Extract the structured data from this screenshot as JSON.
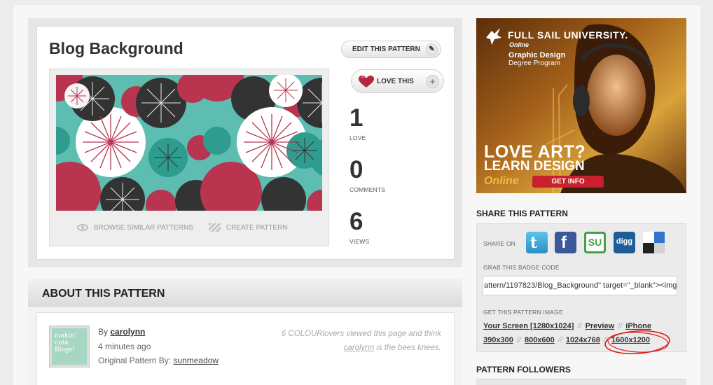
{
  "pattern": {
    "title": "Blog Background",
    "edit_label": "EDIT THIS PATTERN",
    "love_label": "LOVE THIS",
    "browse_label": "BROWSE SIMILAR PATTERNS",
    "create_label": "CREATE PATTERN",
    "stats": [
      {
        "value": "1",
        "label": "LOVE"
      },
      {
        "value": "0",
        "label": "COMMENTS"
      },
      {
        "value": "6",
        "label": "VIEWS"
      }
    ]
  },
  "about": {
    "header": "ABOUT THIS PATTERN",
    "by_prefix": "By",
    "author": "carolynn",
    "time": "4 minutes ago",
    "original_prefix": "Original Pattern By:",
    "original_author": "sunmeadow",
    "viewed_note_1": "6 COLOURlovers viewed this page and think",
    "viewed_note_user": "carolynn",
    "viewed_note_2": "is the bees knees.",
    "avatar_text": "makin' cute Blogs!"
  },
  "ad": {
    "school": "FULL SAIL UNIVERSITY.",
    "online": "Online",
    "program_1": "Graphic Design",
    "program_2": "Degree Program",
    "headline_1": "LOVE ART?",
    "headline_2": "LEARN DESIGN",
    "headline_3": "Online",
    "cta": "GET INFO"
  },
  "share": {
    "title": "SHARE THIS PATTERN",
    "share_on": "SHARE ON",
    "icons": [
      "twitter-icon",
      "facebook-icon",
      "stumbleupon-icon",
      "digg-icon",
      "delicious-icon"
    ],
    "badge_label": "GRAB THIS BADGE CODE",
    "badge_code": "attern/1197823/Blog_Background\" target=\"_blank\"><img",
    "image_label": "GET THIS PATTERN IMAGE",
    "row1": [
      "Your Screen [1280x1024]",
      "Preview",
      "iPhone"
    ],
    "row2": [
      "390x300",
      "800x600",
      "1024x768",
      "1600x1200"
    ],
    "separator": "//"
  },
  "followers": {
    "title": "PATTERN FOLLOWERS"
  }
}
